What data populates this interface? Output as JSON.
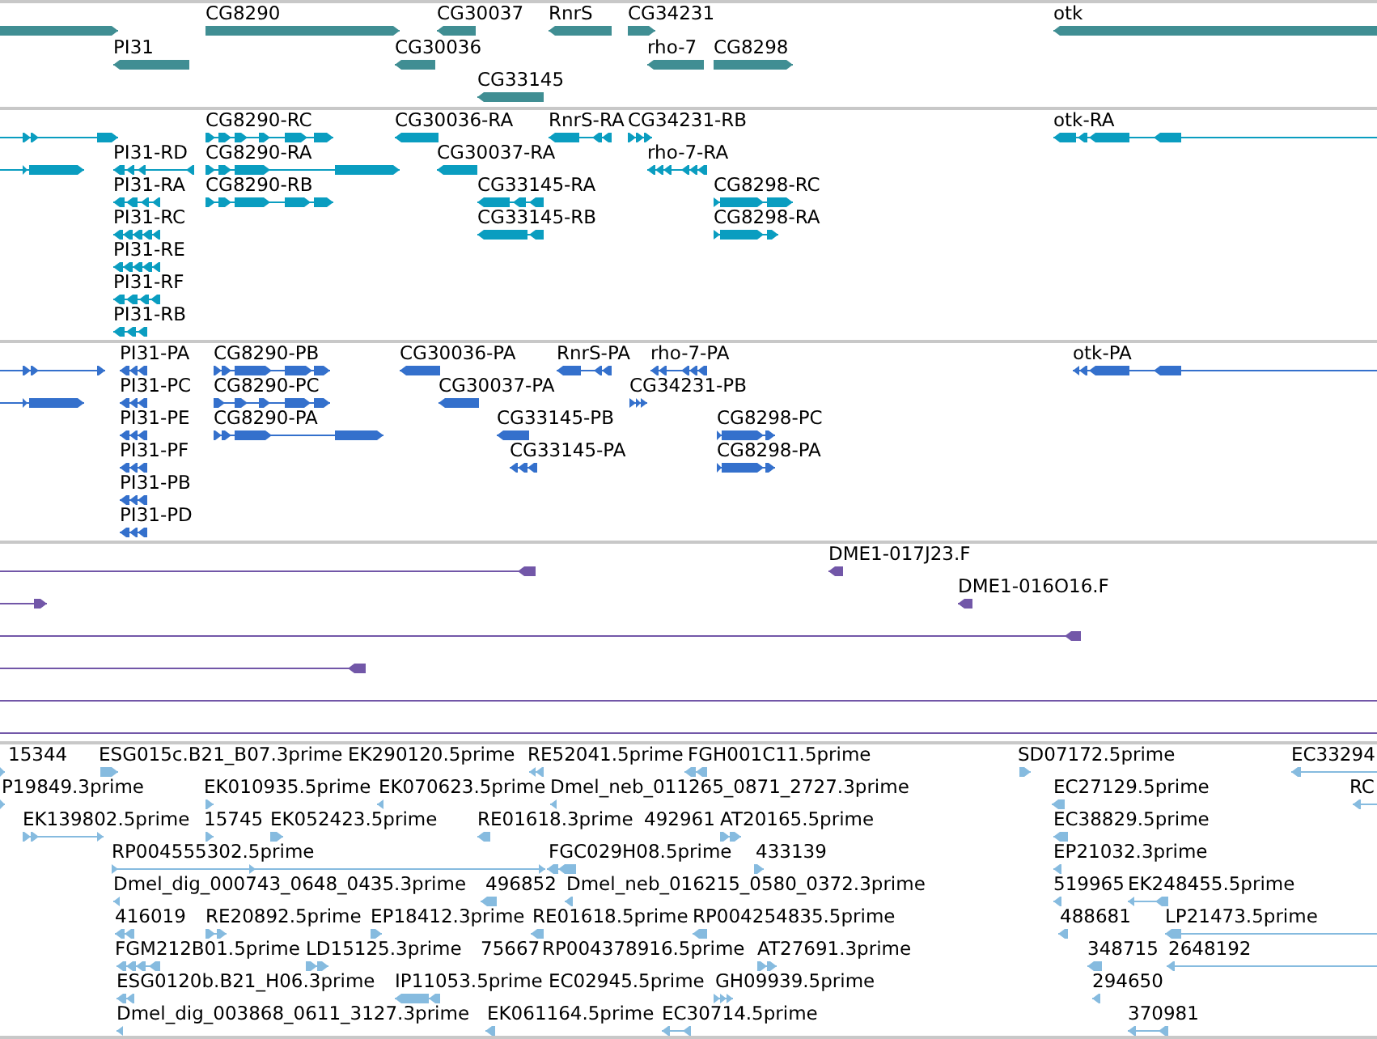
{
  "tracks": [
    {
      "color": "#408e93",
      "features": [
        {
          "reverse": false
        },
        {
          "label": "CG8290",
          "reverse": false
        },
        {
          "label": "CG30037",
          "reverse": true
        },
        {
          "label": "RnrS",
          "reverse": true
        },
        {
          "label": "CG34231",
          "reverse": false
        },
        {
          "label": "otk",
          "reverse": true
        },
        {
          "label": "PI31",
          "reverse": true
        },
        {
          "label": "CG30036",
          "reverse": true
        },
        {
          "label": "rho-7",
          "reverse": true
        },
        {
          "label": "CG8298",
          "reverse": false
        },
        {
          "label": "CG33145",
          "reverse": true
        }
      ]
    },
    {
      "color": "#0a9dc0",
      "features": [
        {
          "reverse": false
        },
        {
          "label": "CG8290-RC",
          "reverse": false
        },
        {
          "label": "CG30036-RA",
          "reverse": true
        },
        {
          "label": "RnrS-RA",
          "reverse": true
        },
        {
          "label": "CG34231-RB",
          "reverse": false
        },
        {
          "label": "otk-RA",
          "reverse": true
        },
        {
          "reverse": false
        },
        {
          "label": "PI31-RD",
          "reverse": true
        },
        {
          "label": "CG8290-RA",
          "reverse": false
        },
        {
          "label": "CG30037-RA",
          "reverse": true
        },
        {
          "label": "rho-7-RA",
          "reverse": true
        },
        {
          "label": "PI31-RA",
          "reverse": true
        },
        {
          "label": "CG8290-RB",
          "reverse": false
        },
        {
          "label": "CG33145-RA",
          "reverse": true
        },
        {
          "label": "CG8298-RC",
          "reverse": false
        },
        {
          "label": "PI31-RC",
          "reverse": true
        },
        {
          "label": "CG33145-RB",
          "reverse": true
        },
        {
          "label": "CG8298-RA",
          "reverse": false
        },
        {
          "label": "PI31-RE",
          "reverse": true
        },
        {
          "label": "PI31-RF",
          "reverse": true
        },
        {
          "label": "PI31-RB",
          "reverse": true
        }
      ]
    },
    {
      "color": "#3470cc",
      "features": [
        {
          "reverse": false
        },
        {
          "label": "PI31-PA",
          "reverse": true
        },
        {
          "label": "CG8290-PB",
          "reverse": false
        },
        {
          "label": "CG30036-PA",
          "reverse": true
        },
        {
          "label": "RnrS-PA",
          "reverse": true
        },
        {
          "label": "rho-7-PA",
          "reverse": true
        },
        {
          "label": "otk-PA",
          "reverse": true
        },
        {
          "reverse": false
        },
        {
          "label": "PI31-PC",
          "reverse": true
        },
        {
          "label": "CG8290-PC",
          "reverse": false
        },
        {
          "label": "CG30037-PA",
          "reverse": true
        },
        {
          "label": "CG34231-PB",
          "reverse": false
        },
        {
          "label": "PI31-PE",
          "reverse": true
        },
        {
          "label": "CG8290-PA",
          "reverse": false
        },
        {
          "label": "CG33145-PB",
          "reverse": true
        },
        {
          "label": "CG8298-PC",
          "reverse": false
        },
        {
          "label": "PI31-PF",
          "reverse": true
        },
        {
          "label": "CG33145-PA",
          "reverse": true
        },
        {
          "label": "CG8298-PA",
          "reverse": false
        },
        {
          "label": "PI31-PB",
          "reverse": true
        },
        {
          "label": "PI31-PD",
          "reverse": true
        }
      ]
    },
    {
      "color": "#7257a8",
      "features": [
        {
          "kind": "arrow",
          "reverse": true
        },
        {
          "kind": "arrow",
          "label": "DME1-017J23.F",
          "reverse": true
        },
        {
          "kind": "arrow",
          "reverse": false
        },
        {
          "kind": "arrow",
          "label": "DME1-016O16.F",
          "reverse": true
        },
        {
          "kind": "arrow",
          "reverse": true
        },
        {
          "kind": "arrow",
          "reverse": true
        },
        {
          "kind": "line"
        },
        {
          "kind": "line"
        }
      ]
    },
    {
      "color": "#86bbdf",
      "features": [
        {
          "label": "15344",
          "reverse": false
        },
        {
          "label": "ESG015c.B21_B07.3prime",
          "reverse": false
        },
        {
          "label": "EK290120.5prime"
        },
        {
          "label": "RE52041.5prime",
          "reverse": true
        },
        {
          "label": "FGH001C11.5prime",
          "reverse": true
        },
        {
          "label": "SD07172.5prime",
          "reverse": false
        },
        {
          "label": "EC33294",
          "reverse": true
        },
        {
          "label": "P19849.3prime",
          "reverse": false
        },
        {
          "label": "EK010935.5prime",
          "reverse": false
        },
        {
          "label": "EK070623.5prime",
          "reverse": true
        },
        {
          "label": "Dmel_neb_011265_0871_2727.3prime",
          "reverse": true
        },
        {
          "label": "EC27129.5prime",
          "reverse": true
        },
        {
          "label": "RC",
          "reverse": true
        },
        {
          "label": "EK139802.5prime",
          "reverse": false
        },
        {
          "label": "15745",
          "reverse": false
        },
        {
          "label": "EK052423.5prime",
          "reverse": false
        },
        {
          "label": "RE01618.3prime",
          "reverse": true
        },
        {
          "label": "492961"
        },
        {
          "label": "AT20165.5prime",
          "reverse": false
        },
        {
          "label": "EC38829.5prime",
          "reverse": true
        },
        {
          "label": "RP004555302.5prime",
          "reverse": false
        },
        {
          "label": "FGC029H08.5prime",
          "reverse": true
        },
        {
          "label": "433139",
          "reverse": false
        },
        {
          "label": "EP21032.3prime",
          "reverse": true
        },
        {
          "label": "Dmel_dig_000743_0648_0435.3prime",
          "reverse": true
        },
        {
          "label": "496852",
          "reverse": true
        },
        {
          "label": "Dmel_neb_016215_0580_0372.3prime",
          "reverse": true
        },
        {
          "label": "519965",
          "reverse": true
        },
        {
          "label": "EK248455.5prime",
          "reverse": true
        },
        {
          "label": "416019",
          "reverse": true
        },
        {
          "label": "RE20892.5prime",
          "reverse": false
        },
        {
          "label": "EP18412.3prime",
          "reverse": false
        },
        {
          "label": "RE01618.5prime",
          "reverse": true
        },
        {
          "label": "RP004254835.5prime",
          "reverse": true
        },
        {
          "label": "488681",
          "reverse": true
        },
        {
          "label": "LP21473.5prime",
          "reverse": true
        },
        {
          "label": "FGM212B01.5prime",
          "reverse": true
        },
        {
          "label": "LD15125.3prime",
          "reverse": false
        },
        {
          "label": "75667"
        },
        {
          "label": "RP004378916.5prime"
        },
        {
          "label": "AT27691.3prime",
          "reverse": false
        },
        {
          "label": "348715",
          "reverse": true
        },
        {
          "label": "2648192",
          "reverse": true
        },
        {
          "label": "ESG0120b.B21_H06.3prime",
          "reverse": true
        },
        {
          "label": "IP11053.5prime",
          "reverse": true
        },
        {
          "label": "EC02945.5prime"
        },
        {
          "label": "GH09939.5prime",
          "reverse": false
        },
        {
          "label": "294650",
          "reverse": true
        },
        {
          "label": "Dmel_dig_003868_0611_3127.3prime",
          "reverse": true
        },
        {
          "label": "EK061164.5prime",
          "reverse": true
        },
        {
          "label": "EC30714.5prime",
          "reverse": true
        },
        {
          "label": "370981",
          "reverse": true
        }
      ]
    }
  ]
}
